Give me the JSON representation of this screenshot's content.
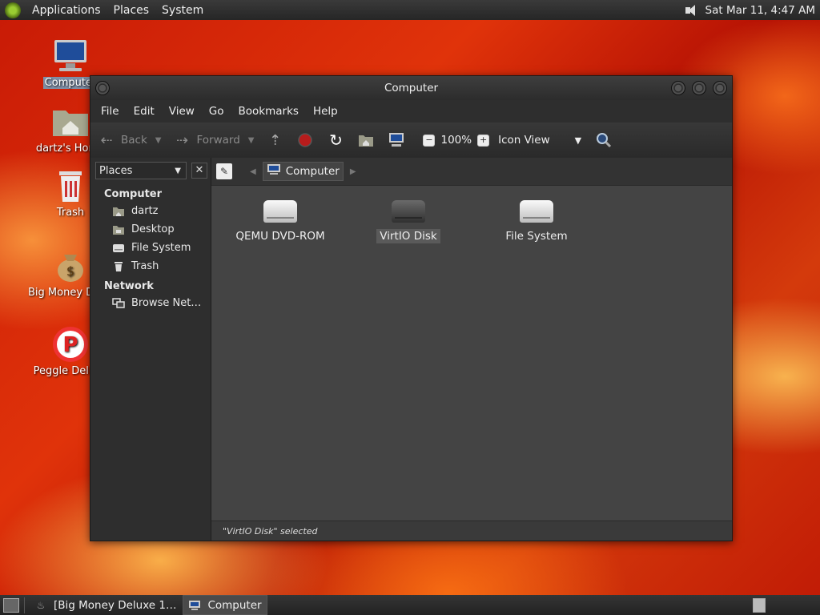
{
  "top_panel": {
    "menus": [
      "Applications",
      "Places",
      "System"
    ],
    "clock": "Sat Mar 11,  4:47 AM"
  },
  "desktop_icons": [
    {
      "label": "Computer",
      "icon": "computer-icon"
    },
    {
      "label": "dartz's Home",
      "icon": "home-folder-icon"
    },
    {
      "label": "Trash",
      "icon": "trash-icon"
    },
    {
      "label": "Big Money Deluxe",
      "icon": "money-bag-icon"
    },
    {
      "label": "Peggle Deluxe",
      "icon": "peggle-icon"
    }
  ],
  "window": {
    "title": "Computer",
    "menus": [
      "File",
      "Edit",
      "View",
      "Go",
      "Bookmarks",
      "Help"
    ],
    "toolbar": {
      "back_label": "Back",
      "forward_label": "Forward",
      "zoom": "100%",
      "view_mode": "Icon View"
    },
    "sidebar": {
      "selector": "Places",
      "groups": [
        {
          "title": "Computer",
          "items": [
            {
              "label": "dartz",
              "icon": "home-icon"
            },
            {
              "label": "Desktop",
              "icon": "desktop-icon"
            },
            {
              "label": "File System",
              "icon": "drive-icon"
            },
            {
              "label": "Trash",
              "icon": "trash-icon"
            }
          ]
        },
        {
          "title": "Network",
          "items": [
            {
              "label": "Browse Net…",
              "icon": "network-icon"
            }
          ]
        }
      ]
    },
    "location": "Computer",
    "items": [
      {
        "label": "QEMU DVD-ROM",
        "icon": "dvd-drive-icon",
        "selected": false
      },
      {
        "label": "VirtIO Disk",
        "icon": "hard-disk-icon",
        "selected": true
      },
      {
        "label": "File System",
        "icon": "hard-disk-icon",
        "selected": false
      }
    ],
    "status": "\"VirtIO Disk\" selected"
  },
  "bottom_panel": {
    "tasks": [
      "[Big Money Deluxe 1…",
      "Computer"
    ]
  },
  "colors": {
    "panel": "#2a2a2a",
    "window_bg": "#3c3c3c",
    "content_bg": "#444444",
    "selection": "#7f8fa6"
  }
}
